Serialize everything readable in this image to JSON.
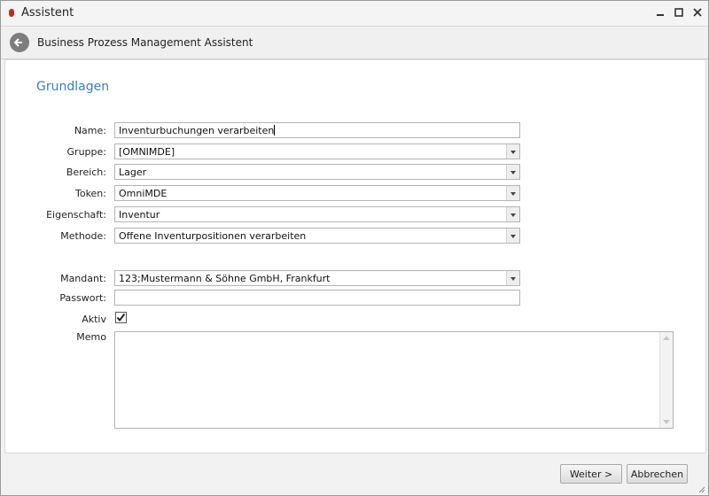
{
  "window": {
    "title": "Assistent"
  },
  "header": {
    "title": "Business Prozess Management Assistent"
  },
  "section": {
    "title": "Grundlagen"
  },
  "form": {
    "name": {
      "label": "Name:",
      "value": "Inventurbuchungen verarbeiten"
    },
    "gruppe": {
      "label": "Gruppe:",
      "value": "[OMNIMDE]"
    },
    "bereich": {
      "label": "Bereich:",
      "value": "Lager"
    },
    "token": {
      "label": "Token:",
      "value": "OmniMDE"
    },
    "eigenschaft": {
      "label": "Eigenschaft:",
      "value": "Inventur"
    },
    "methode": {
      "label": "Methode:",
      "value": "Offene Inventurpositionen verarbeiten"
    },
    "mandant": {
      "label": "Mandant:",
      "value": "123;Mustermann & Söhne GmbH, Frankfurt"
    },
    "passwort": {
      "label": "Passwort:",
      "value": ""
    },
    "aktiv": {
      "label": "Aktiv",
      "checked": true
    },
    "memo": {
      "label": "Memo",
      "value": ""
    }
  },
  "buttons": {
    "next": "Weiter >",
    "cancel": "Abbrechen"
  }
}
